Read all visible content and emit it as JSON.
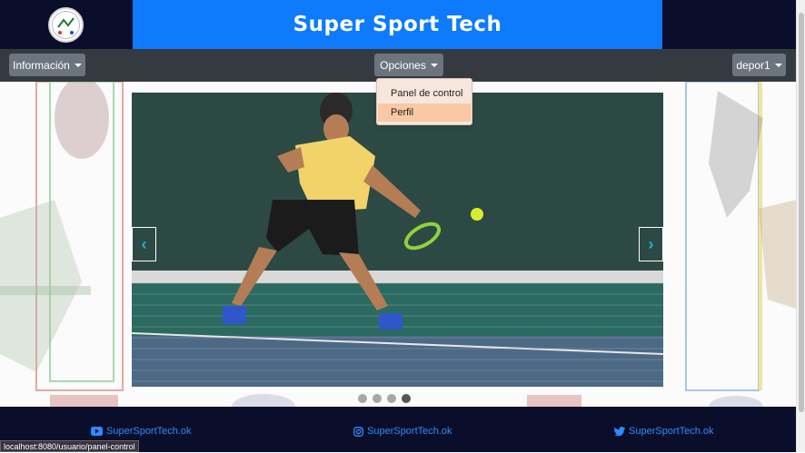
{
  "header": {
    "title": "Super Sport Tech"
  },
  "nav": {
    "informacion": "Información",
    "opciones": "Opciones",
    "user": "depor1"
  },
  "dropdown": {
    "items": [
      "Panel de control",
      "Perfil"
    ]
  },
  "carousel": {
    "prev": "‹",
    "next": "›",
    "dots": 4,
    "active_dot": 3
  },
  "footer": {
    "youtube": "SuperSportTech.ok",
    "instagram": "SuperSportTech.ok",
    "twitter": "SuperSportTech.ok"
  },
  "status_url": "localhost:8080/usuario/panel-control",
  "colors": {
    "title_bg": "#0d7bfb",
    "nav_bg": "#343a40",
    "footer_bg": "#0b0e2a",
    "link": "#2b8cff"
  }
}
